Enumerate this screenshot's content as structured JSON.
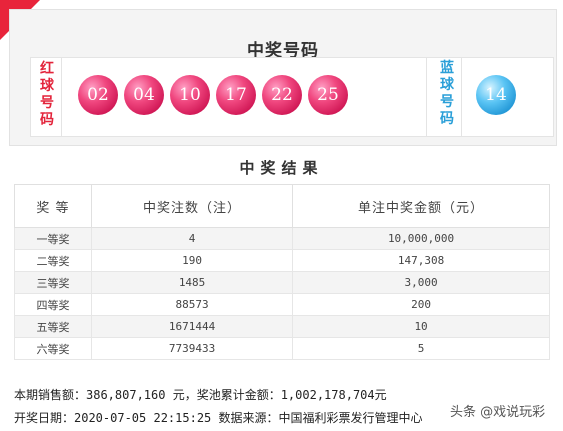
{
  "top": {
    "title": "中奖号码"
  },
  "red_label": "红球号码",
  "blue_label": "蓝球号码",
  "red_balls": [
    "02",
    "04",
    "10",
    "17",
    "22",
    "25"
  ],
  "blue_ball": "14",
  "results": {
    "title": "中奖结果",
    "headers": [
      "奖  等",
      "中奖注数（注）",
      "单注中奖金额（元）"
    ],
    "rows": [
      {
        "level": "一等奖",
        "count": "4",
        "amount": "10,000,000"
      },
      {
        "level": "二等奖",
        "count": "190",
        "amount": "147,308"
      },
      {
        "level": "三等奖",
        "count": "1485",
        "amount": "3,000"
      },
      {
        "level": "四等奖",
        "count": "88573",
        "amount": "200"
      },
      {
        "level": "五等奖",
        "count": "1671444",
        "amount": "10"
      },
      {
        "level": "六等奖",
        "count": "7739433",
        "amount": "5"
      }
    ]
  },
  "footer": {
    "sales": "本期销售额：386,807,160 元，奖池累计金额：1,002,178,704元",
    "draw_info": "开奖日期：2020-07-05 22:15:25 数据来源：中国福利彩票发行管理中心"
  },
  "watermark": "头条 @戏说玩彩",
  "colors": {
    "red": "#e3243b",
    "blue": "#2a9fd8",
    "corner": "#e8243b"
  }
}
